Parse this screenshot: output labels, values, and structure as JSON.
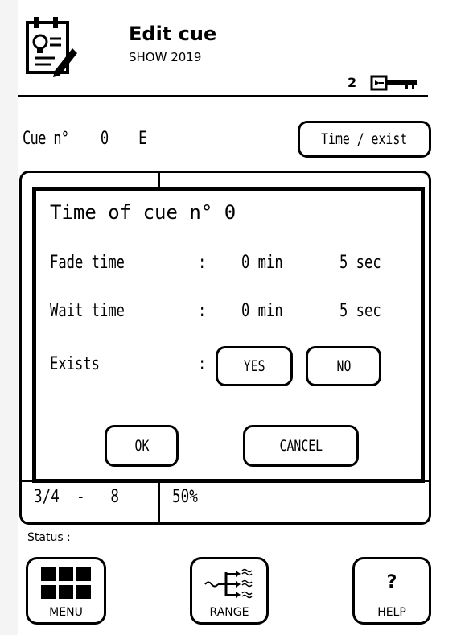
{
  "header": {
    "icon": "notepad-pencil-icon",
    "title": "Edit cue",
    "subtitle": "SHOW 2019",
    "level": "2",
    "key_icon": "key-icon"
  },
  "cue": {
    "label": "Cue n°",
    "number": "0",
    "flag": "E",
    "time_exist_button": "Time / exist"
  },
  "list": {
    "left_value": "3/4  -   8",
    "right_value": "50%"
  },
  "dialog": {
    "title": "Time of cue n° 0",
    "rows": [
      {
        "label": "Fade time",
        "sep": ":",
        "min": "0 min",
        "sec": "5 sec"
      },
      {
        "label": "Wait time",
        "sep": ":",
        "min": "0 min",
        "sec": "5 sec"
      }
    ],
    "exists": {
      "label": "Exists",
      "sep": ":",
      "yes": "YES",
      "no": "NO"
    },
    "ok": "OK",
    "cancel": "CANCEL"
  },
  "status_label": "Status :",
  "toolbar": {
    "menu": {
      "label": "MENU",
      "icon": "grid-icon"
    },
    "range": {
      "label": "RANGE",
      "icon": "range-icon"
    },
    "help": {
      "label": "HELP",
      "icon": "question-icon",
      "glyph": "?"
    }
  }
}
